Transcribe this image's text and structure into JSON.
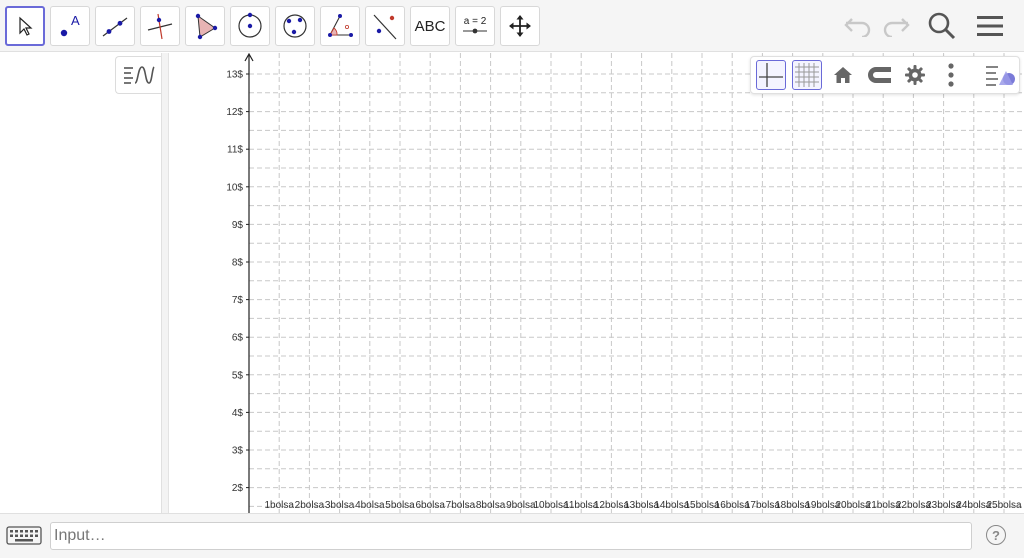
{
  "toolbar": {
    "tools": [
      {
        "id": "move",
        "icon": "cursor-arrow-icon"
      },
      {
        "id": "point",
        "icon": "point-icon",
        "label": "A"
      },
      {
        "id": "line",
        "icon": "line-through-points-icon"
      },
      {
        "id": "perpendicular",
        "icon": "perpendicular-line-icon"
      },
      {
        "id": "polygon",
        "icon": "polygon-icon"
      },
      {
        "id": "circle",
        "icon": "circle-center-point-icon"
      },
      {
        "id": "ellipse",
        "icon": "circle-three-points-icon"
      },
      {
        "id": "angle",
        "icon": "angle-icon"
      },
      {
        "id": "reflect",
        "icon": "reflect-about-line-icon"
      },
      {
        "id": "text",
        "icon": "text-icon",
        "label": "ABC"
      },
      {
        "id": "slider",
        "icon": "slider-icon",
        "label": "a = 2"
      },
      {
        "id": "move-graphics",
        "icon": "move-graphics-view-icon"
      }
    ],
    "right": [
      "undo-icon",
      "redo-icon",
      "search-icon",
      "menu-icon"
    ]
  },
  "algebra": {
    "toggle_icon": "algebra-view-toggle-icon"
  },
  "stylebar": {
    "buttons": [
      "axes-icon",
      "grid-icon",
      "home-icon",
      "point-capturing-icon",
      "settings-icon",
      "more-icon",
      "style-bar-toggle-icon"
    ],
    "axes_on": true,
    "grid_on": true
  },
  "graph": {
    "y_ticks": [
      "13$",
      "12$",
      "11$",
      "10$",
      "9$",
      "8$",
      "7$",
      "6$",
      "5$",
      "4$",
      "3$",
      "2$"
    ],
    "x_ticks": [
      "1bolsa",
      "2bolsa",
      "3bolsa",
      "4bolsa",
      "5bolsa",
      "6bolsa",
      "7bolsa",
      "8bolsa",
      "9bolsa",
      "10bolsa",
      "11bolsa",
      "12bolsa",
      "13bolsa",
      "14bolsa",
      "15bolsa",
      "16bolsa",
      "17bolsa",
      "18bolsa",
      "19bolsa",
      "20bolsa",
      "21bolsa",
      "22bolsa",
      "23bolsa",
      "24bolsa",
      "25bolsa"
    ],
    "grid_color": "#c8c8c8",
    "axis_color": "#222222"
  },
  "input": {
    "placeholder": "Input…",
    "value": ""
  },
  "colors": {
    "accent": "#6a6ad8",
    "point": "#1a1aa6",
    "line": "#333333"
  }
}
